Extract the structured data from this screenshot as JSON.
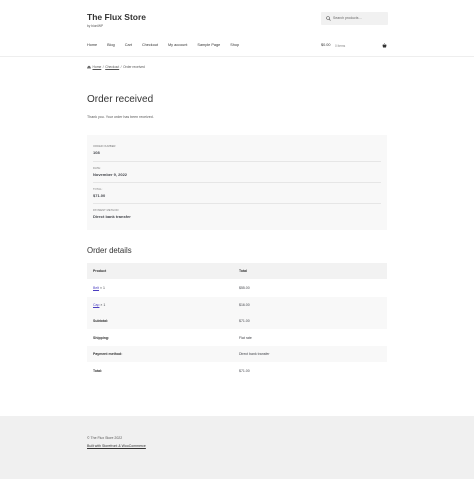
{
  "site": {
    "title": "The Flux Store",
    "tagline": "by bioniWP"
  },
  "search": {
    "placeholder": "Search products…",
    "icon": "search-icon"
  },
  "nav": {
    "items": [
      "Home",
      "Blog",
      "Cart",
      "Checkout",
      "My account",
      "Sample Page",
      "Shop"
    ]
  },
  "cart": {
    "total": "$0.00",
    "count": "0 items",
    "icon": "basket-icon"
  },
  "breadcrumb": {
    "home": "Home",
    "checkout": "Checkout",
    "current": "Order received",
    "separator": "/"
  },
  "page": {
    "title": "Order received",
    "thanks": "Thank you. Your order has been received."
  },
  "overview": [
    {
      "label": "Order number:",
      "value": "108"
    },
    {
      "label": "Date:",
      "value": "November 9, 2022"
    },
    {
      "label": "Total:",
      "value": "$71.00"
    },
    {
      "label": "Payment method:",
      "value": "Direct bank transfer"
    }
  ],
  "order_details": {
    "title": "Order details",
    "headers": {
      "product": "Product",
      "total": "Total"
    },
    "items": [
      {
        "name": "Belt",
        "qty": "× 1",
        "total": "$55.00"
      },
      {
        "name": "Cap",
        "qty": "× 1",
        "total": "$16.00"
      }
    ],
    "summary": [
      {
        "label": "Subtotal:",
        "value": "$71.00"
      },
      {
        "label": "Shipping:",
        "value": "Flat rate"
      },
      {
        "label": "Payment method:",
        "value": "Direct bank transfer"
      },
      {
        "label": "Total:",
        "value": "$71.00"
      }
    ]
  },
  "footer": {
    "copyright": "© The Flux Store 2022",
    "built": "Built with Storefront & WooCommerce"
  },
  "colors": {
    "link": "#4b3ec1",
    "footer_bg": "#f0f0f0",
    "panel_bg": "#f8f8f8"
  }
}
